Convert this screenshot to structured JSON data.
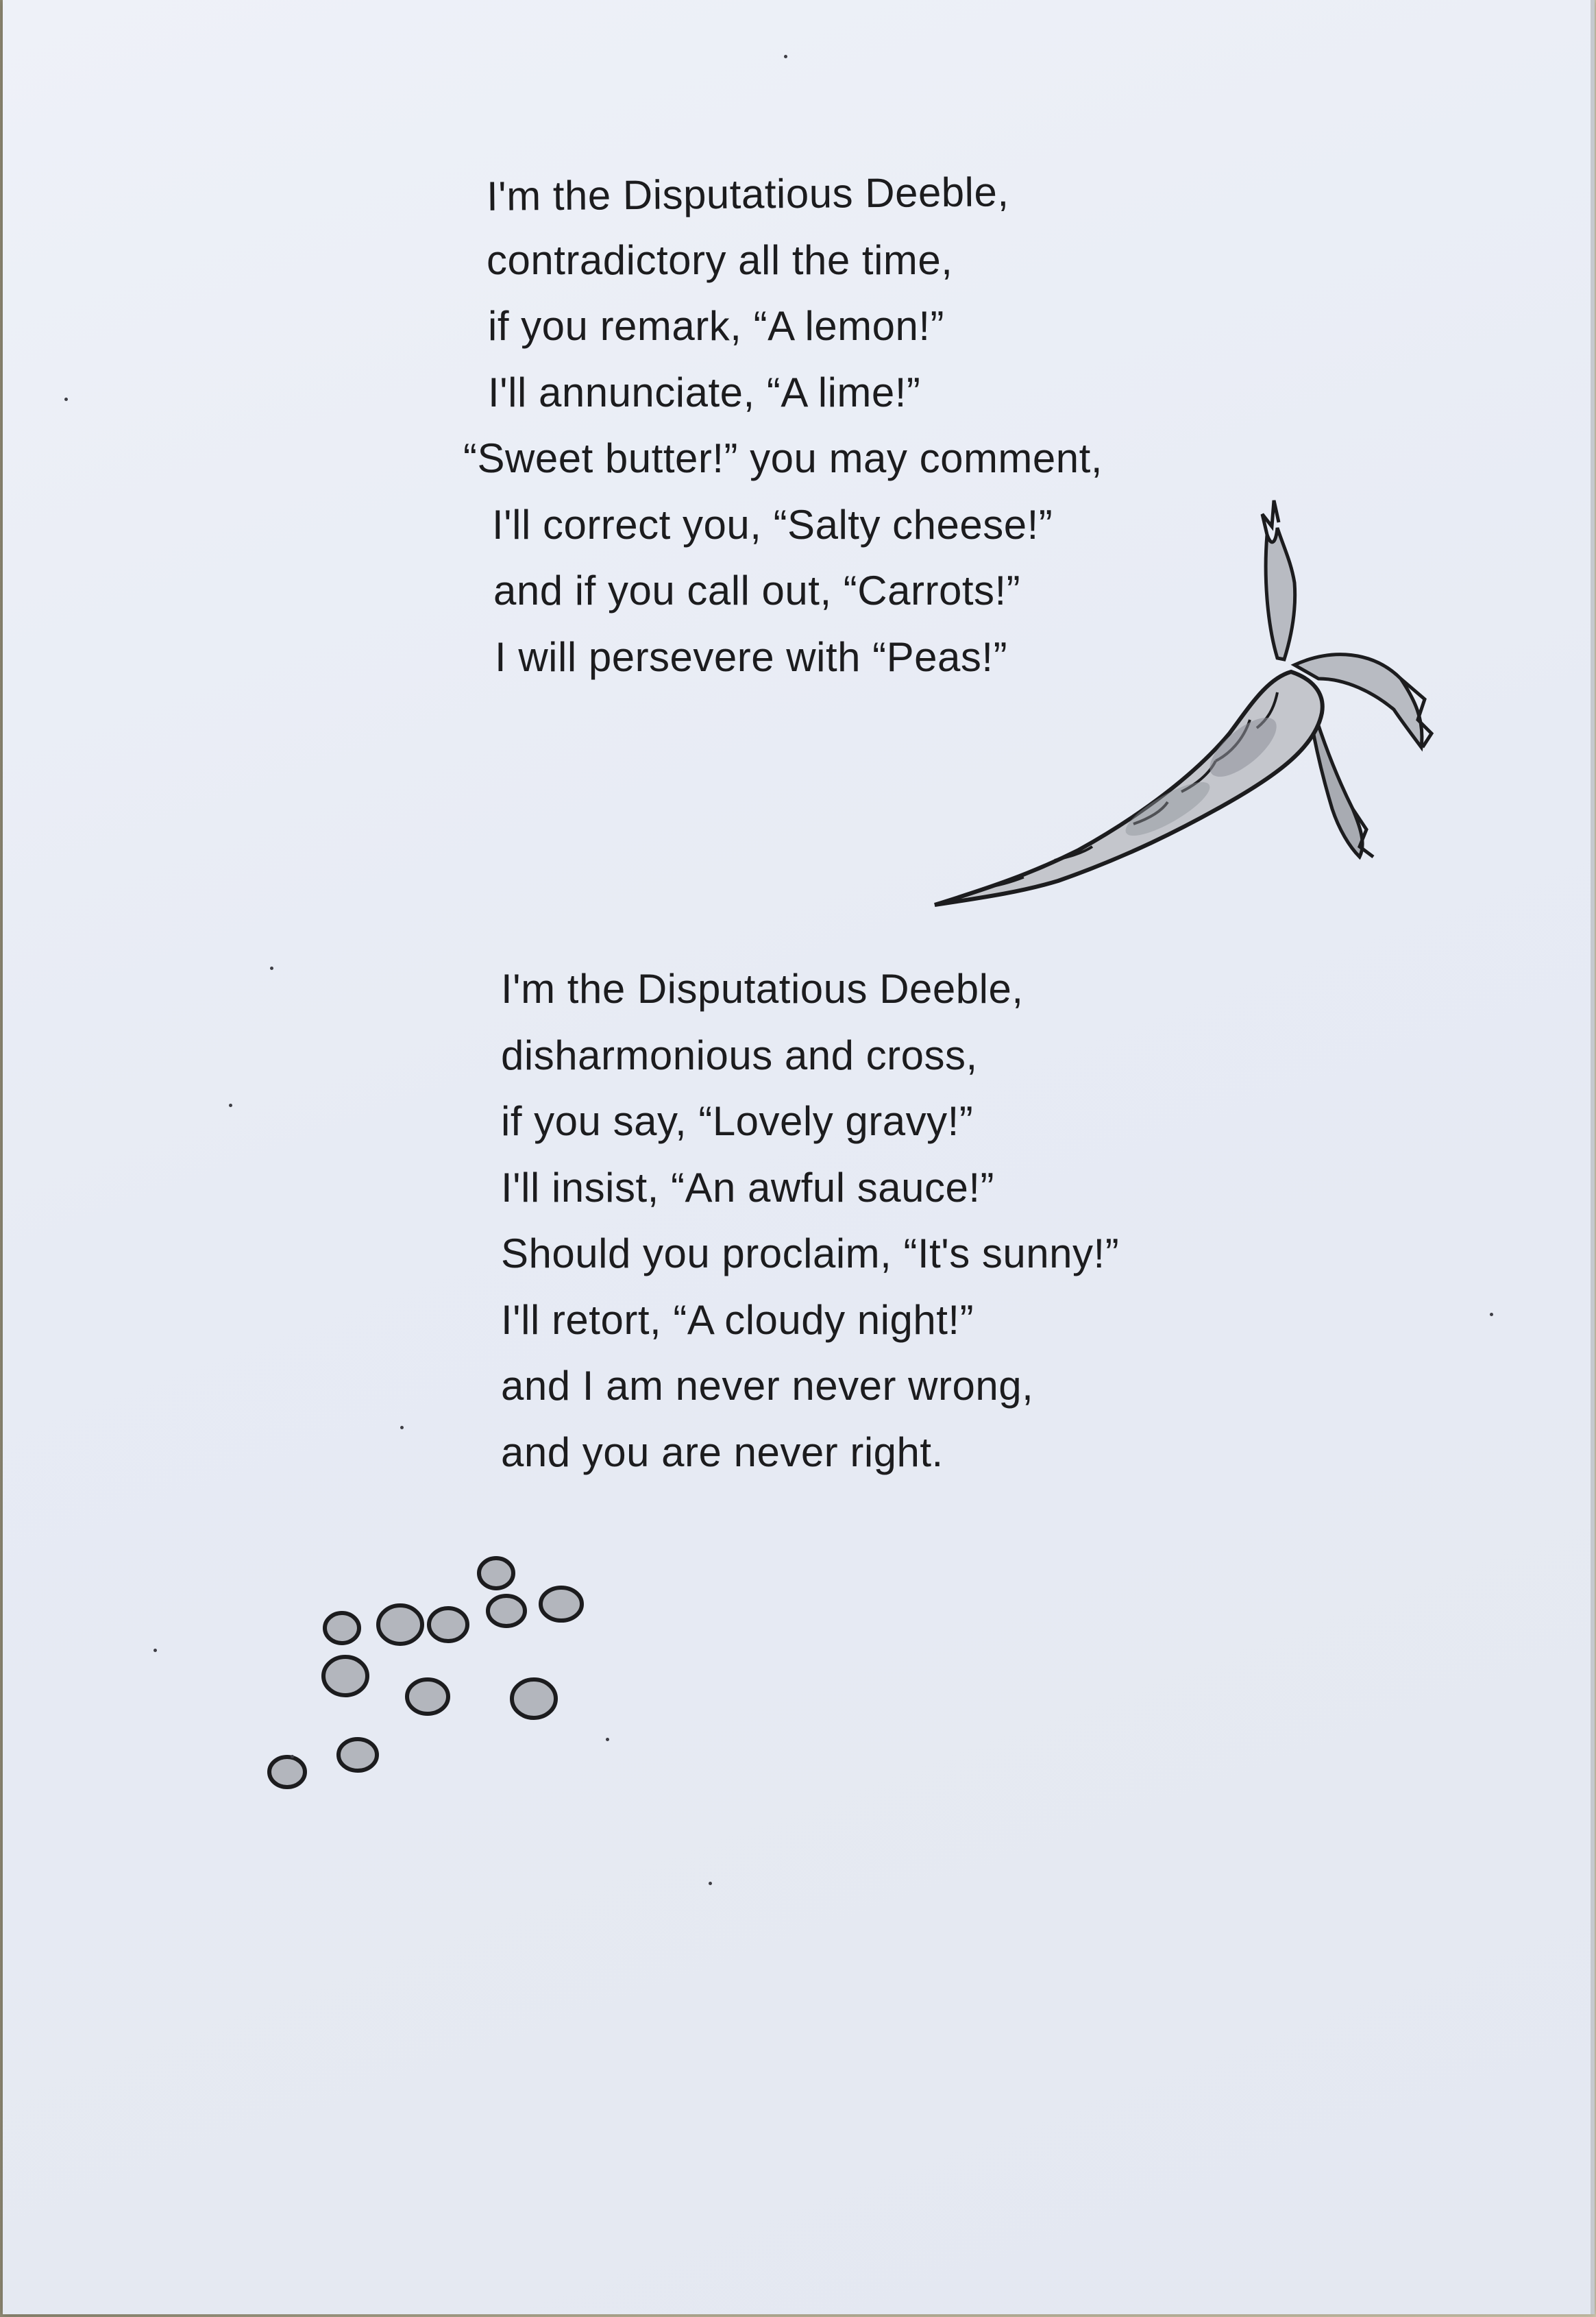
{
  "poem": {
    "stanzas": [
      {
        "lines": [
          "I'm the Disputatious Deeble,",
          "contradictory all the time,",
          "if you remark, “A lemon!”",
          "I'll annunciate, “A lime!”",
          "“Sweet butter!” you may comment,",
          "I'll correct you, “Salty cheese!”",
          "and if you call out, “Carrots!”",
          "I will persevere with “Peas!”"
        ]
      },
      {
        "lines": [
          "I'm the Disputatious Deeble,",
          "disharmonious and cross,",
          "if you say, “Lovely gravy!”",
          "I'll insist, “An awful sauce!”",
          "Should you proclaim, “It's sunny!”",
          "I'll retort, “A cloudy night!”",
          "and I am never never wrong,",
          "and you are never right."
        ]
      }
    ]
  },
  "illustrations": [
    {
      "name": "carrot-illustration"
    },
    {
      "name": "peas-illustration"
    }
  ],
  "colors": {
    "paper": "#e9edf5",
    "ink": "#1c1c1e",
    "shading": "#9a9ca3",
    "tabletop": "#b9b197"
  }
}
